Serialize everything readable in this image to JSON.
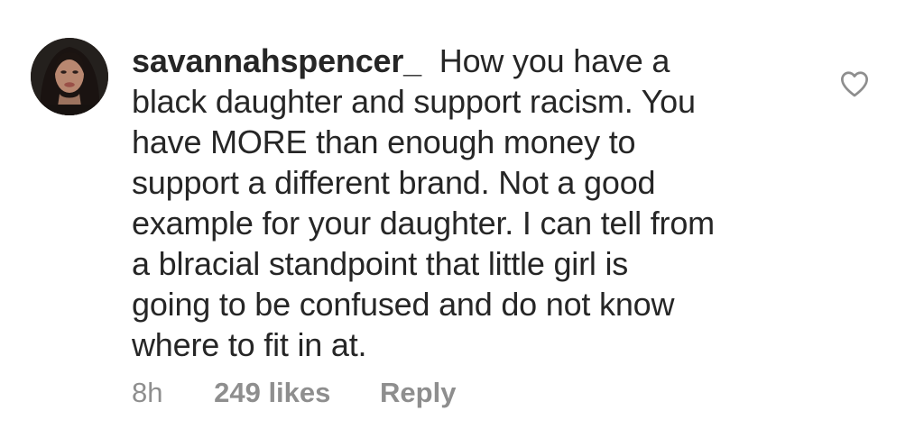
{
  "comment": {
    "avatar_icon": "profile-photo",
    "username": "savannahspencer_",
    "text_lines": [
      "How you have a",
      "black daughter and support racism. You",
      "have MORE than enough money to",
      "support a different brand. Not a good",
      "example for your daughter. I can tell from",
      "a blracial standpoint that little girl is",
      "going to be confused and do not know",
      "where to fit in at."
    ],
    "timestamp": "8h",
    "likes": "249 likes",
    "reply_label": "Reply",
    "like_icon": "heart-outline-icon"
  },
  "colors": {
    "text": "#262626",
    "meta": "#8e8e8e",
    "background": "#ffffff",
    "heart_stroke": "#8e8e8e"
  }
}
